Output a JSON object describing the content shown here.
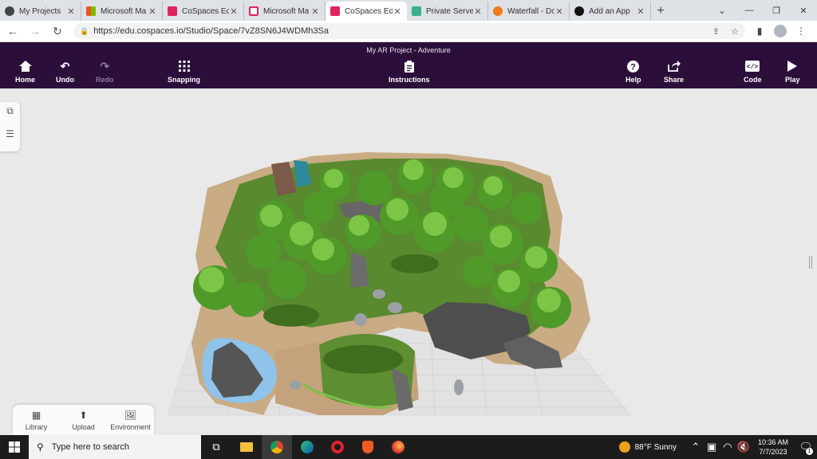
{
  "browser": {
    "tabs": [
      {
        "title": "My Projects",
        "color": "#444444",
        "active": false
      },
      {
        "title": "Microsoft Ma",
        "color": "#f25022",
        "active": false
      },
      {
        "title": "CoSpaces Edu",
        "color": "#e0245e",
        "active": false
      },
      {
        "title": "Microsoft Ma",
        "color": "#e0245e",
        "active": false
      },
      {
        "title": "CoSpaces Edu",
        "color": "#e0245e",
        "active": true
      },
      {
        "title": "Private Server",
        "color": "#3cb08c",
        "active": false
      },
      {
        "title": "Waterfall - Do",
        "color": "#f07b1a",
        "active": false
      },
      {
        "title": "Add an App",
        "color": "#111111",
        "active": false
      }
    ],
    "url": "https://edu.cospaces.io/Studio/Space/7vZ8SN6J4WDMh3Sa"
  },
  "app": {
    "project_title": "My AR Project - Adventure",
    "buttons": {
      "home": "Home",
      "undo": "Undo",
      "redo": "Redo",
      "snapping": "Snapping",
      "instructions": "Instructions",
      "help": "Help",
      "share": "Share",
      "code": "Code",
      "play": "Play"
    },
    "header_color": "#2b0f3a"
  },
  "bottom_panel": {
    "library": "Library",
    "upload": "Upload",
    "environment": "Environment"
  },
  "taskbar": {
    "search_placeholder": "Type here to search",
    "weather": "88°F  Sunny",
    "time": "10:36 AM",
    "date": "7/7/2023",
    "notifications": "1"
  }
}
